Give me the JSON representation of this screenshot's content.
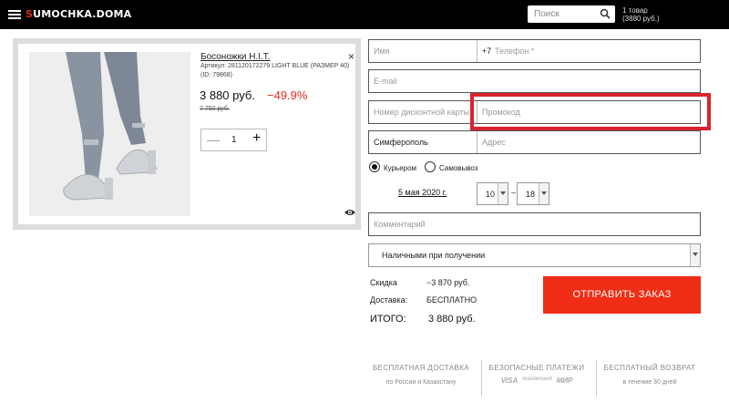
{
  "header": {
    "logo_prefix": "S",
    "logo_rest": "UMOCHKA.DOMA",
    "search_placeholder": "Поиск",
    "cart_count": "1 товар",
    "cart_total": "(3880 руб.)"
  },
  "product": {
    "title": "Босоножки H.I.T.",
    "article_line1": "Артикул: 281120172279 LIGHT BLUE (РАЗМЕР 40)",
    "article_line2": "(ID: 79868)",
    "price": "3 880 руб.",
    "discount": "−49.9%",
    "old_price": "7 750 руб.",
    "quantity": "1",
    "close": "×",
    "minus": "—",
    "plus": "+"
  },
  "form": {
    "name_placeholder": "Имя",
    "phone_prefix": "+7",
    "phone_placeholder": "Телефон *",
    "email_placeholder": "E-mail",
    "card_placeholder": "Номер дисконтной карты",
    "promo_placeholder": "Промокод",
    "city_value": "Симферополь",
    "address_placeholder": "Адрес",
    "delivery_courier": "Курьером",
    "delivery_pickup": "Самовывоз",
    "delivery_date": "5 мая 2020 г.",
    "time_from": "10",
    "time_to": "18",
    "time_dash": "–",
    "comment_placeholder": "Комментарий",
    "payment_value": "Наличными при получении"
  },
  "summary": {
    "discount_label": "Скидка",
    "discount_value": "−3 870 руб.",
    "delivery_label": "Доставка:",
    "delivery_value": "БЕСПЛАТНО",
    "total_label": "ИТОГО:",
    "total_value": "3 880 руб.",
    "submit_label": "ОТПРАВИТЬ ЗАКАЗ"
  },
  "features": [
    {
      "title": "БЕСПЛАТНАЯ ДОСТАВКА",
      "sub": "по России и Казахстану"
    },
    {
      "title": "БЕЗОПАСНЫЕ ПЛАТЕЖИ",
      "sub": ""
    },
    {
      "title": "БЕСПЛАТНЫЙ ВОЗВРАТ",
      "sub": "в течение 30 дней"
    }
  ],
  "payment_logos": [
    "VISA",
    "mastercard",
    "МИР"
  ],
  "colors": {
    "accent": "#f02d16",
    "highlight": "#d9232d",
    "header_bg": "#000000"
  }
}
